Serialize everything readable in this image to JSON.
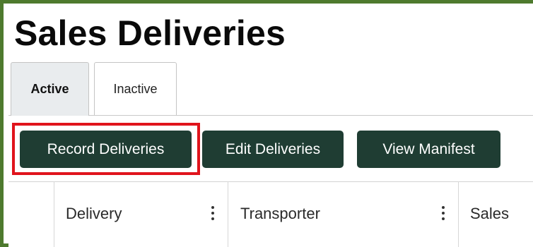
{
  "page": {
    "title": "Sales Deliveries"
  },
  "tabs": [
    {
      "label": "Active",
      "active": true
    },
    {
      "label": "Inactive",
      "active": false
    }
  ],
  "toolbar": {
    "record_label": "Record Deliveries",
    "edit_label": "Edit Deliveries",
    "manifest_label": "View Manifest"
  },
  "table": {
    "columns": [
      {
        "label": "Delivery"
      },
      {
        "label": "Transporter"
      },
      {
        "label": "Sales"
      }
    ]
  },
  "colors": {
    "button": "#1f3d33",
    "highlight": "#e0141c",
    "frame": "#4e7a2e"
  },
  "icons": [
    "column-menu-icon"
  ]
}
